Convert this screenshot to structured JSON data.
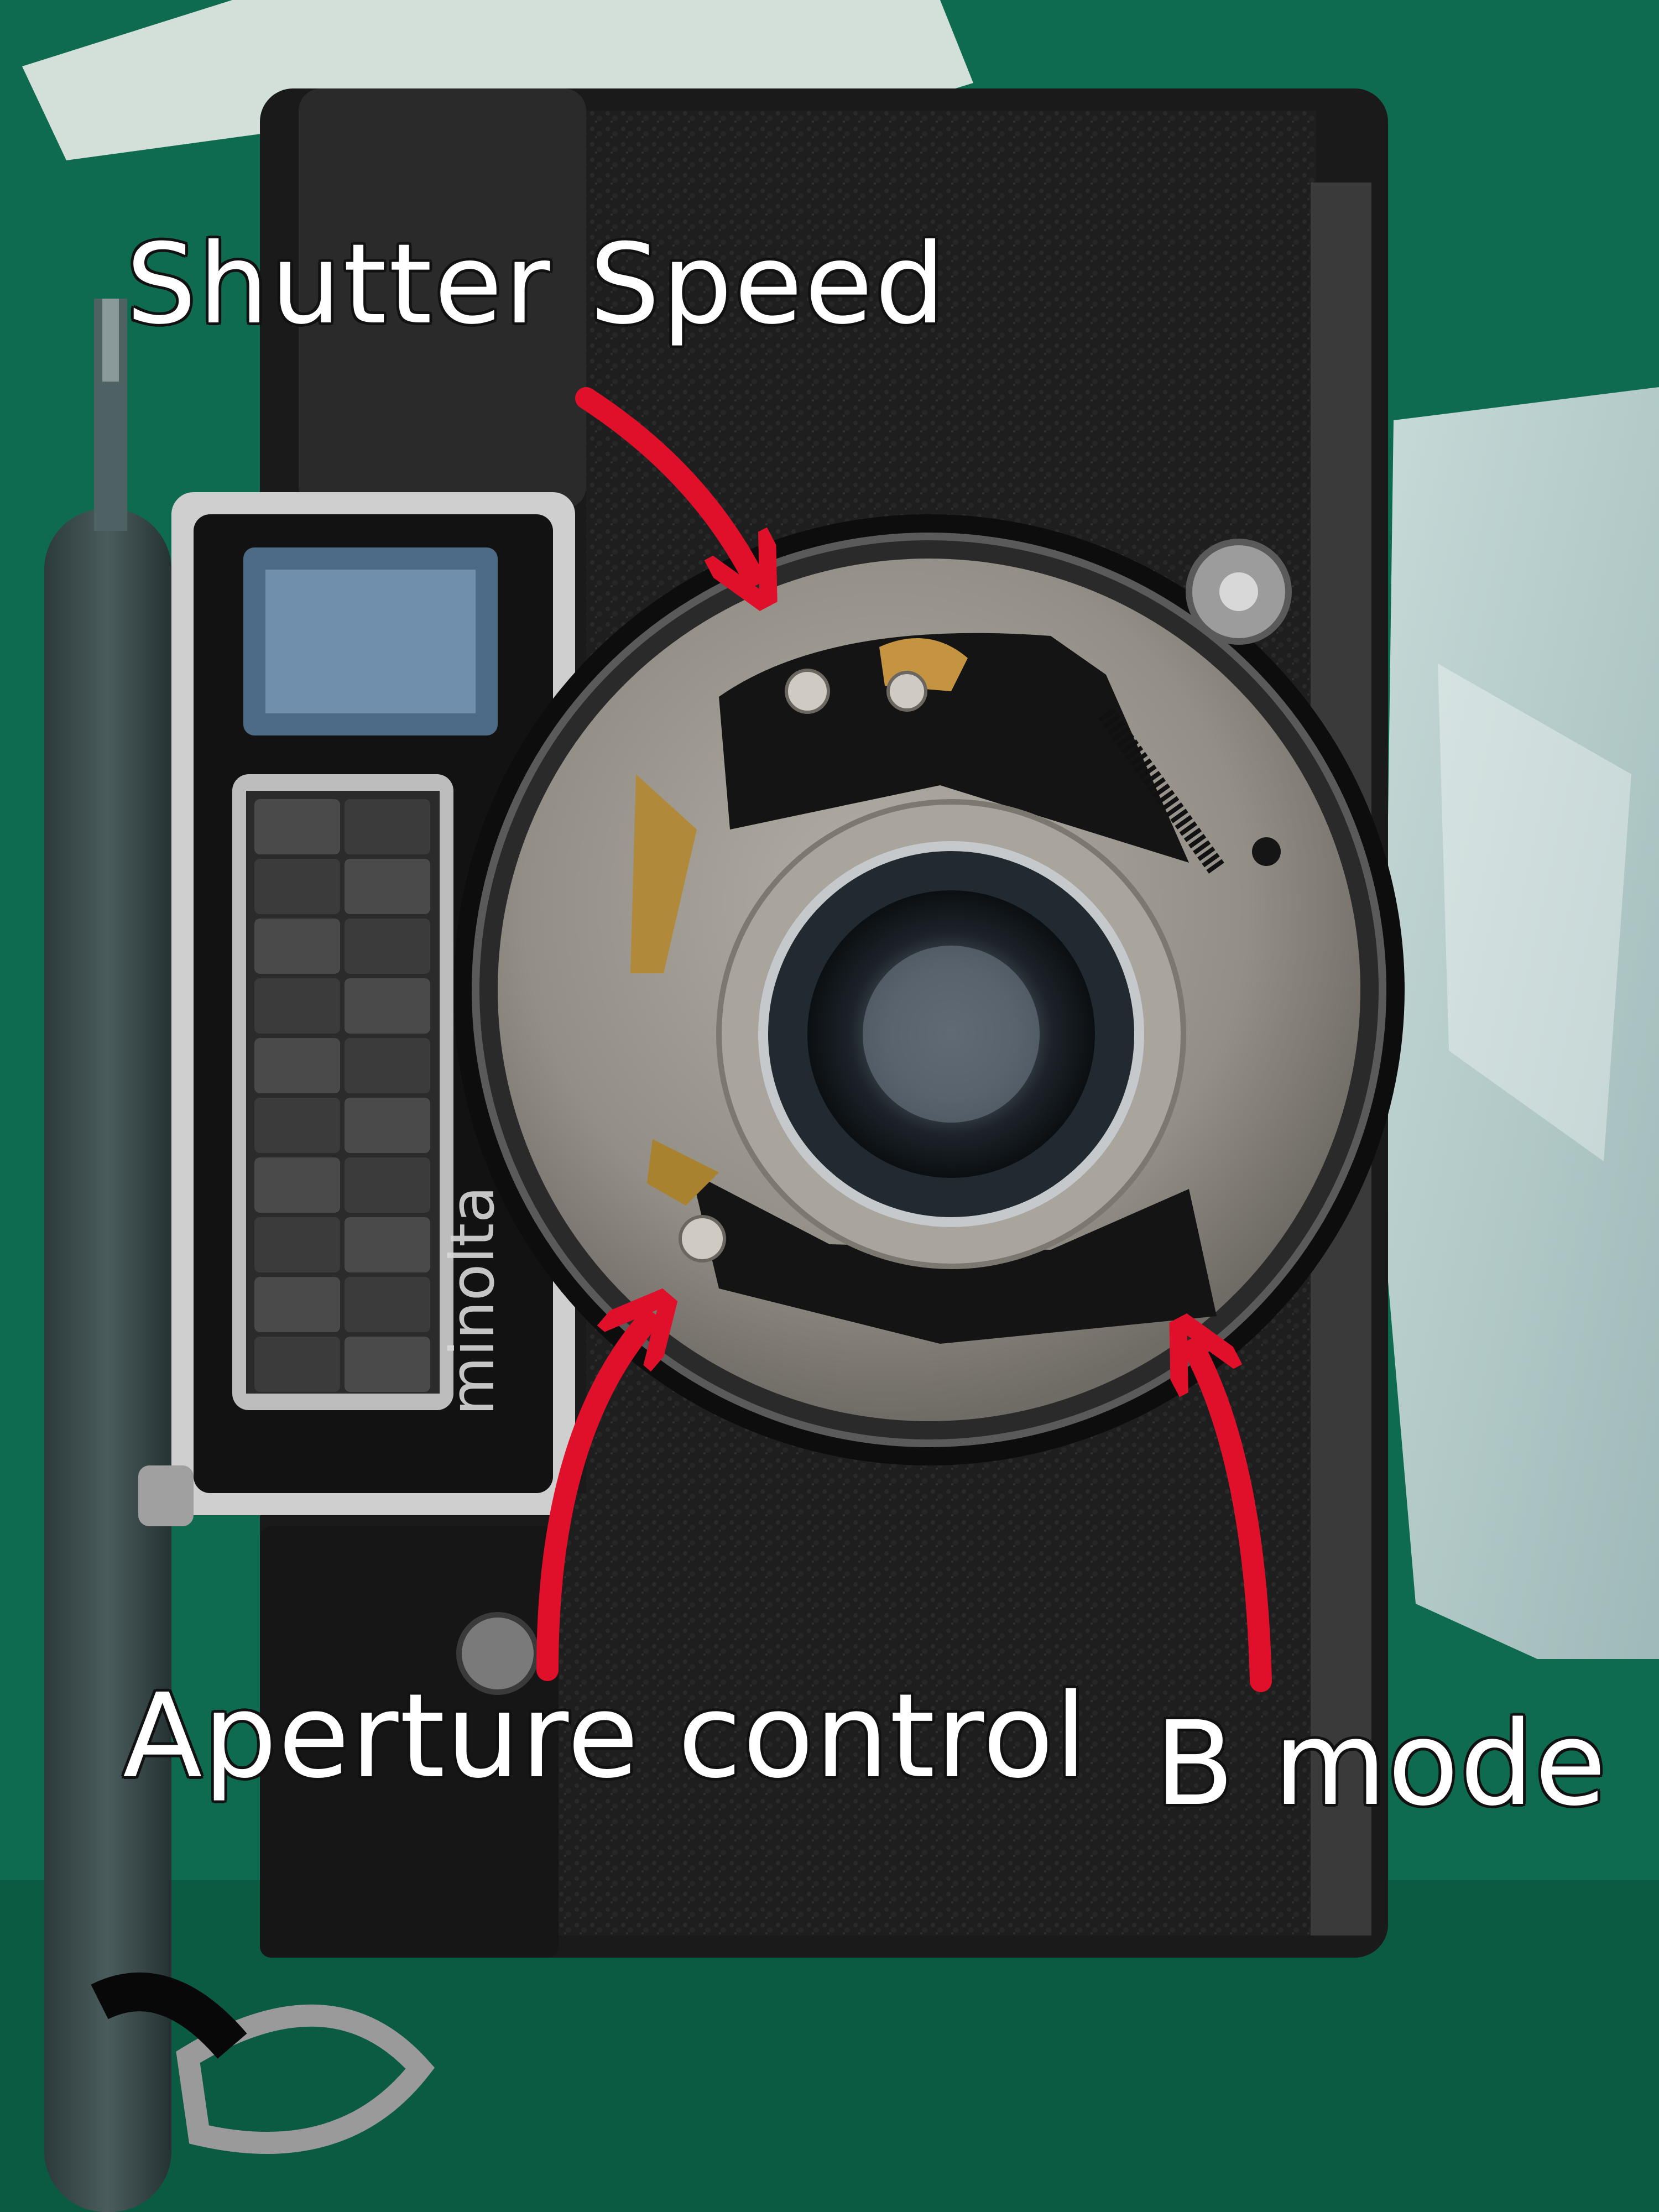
{
  "annotations": {
    "shutter_speed": "Shutter Speed",
    "aperture_control": "Aperture control",
    "b_mode": "B mode"
  },
  "camera": {
    "brand_text": "minolta"
  },
  "colors": {
    "background_mat": "#0f6b4f",
    "camera_body": "#1a1a1a",
    "leatherette": "#222222",
    "shutter_plate": "#9a9690",
    "brass_parts": "#b08a3a",
    "annotation_arrows": "#e0102a",
    "annotation_text": "#ffffff"
  }
}
